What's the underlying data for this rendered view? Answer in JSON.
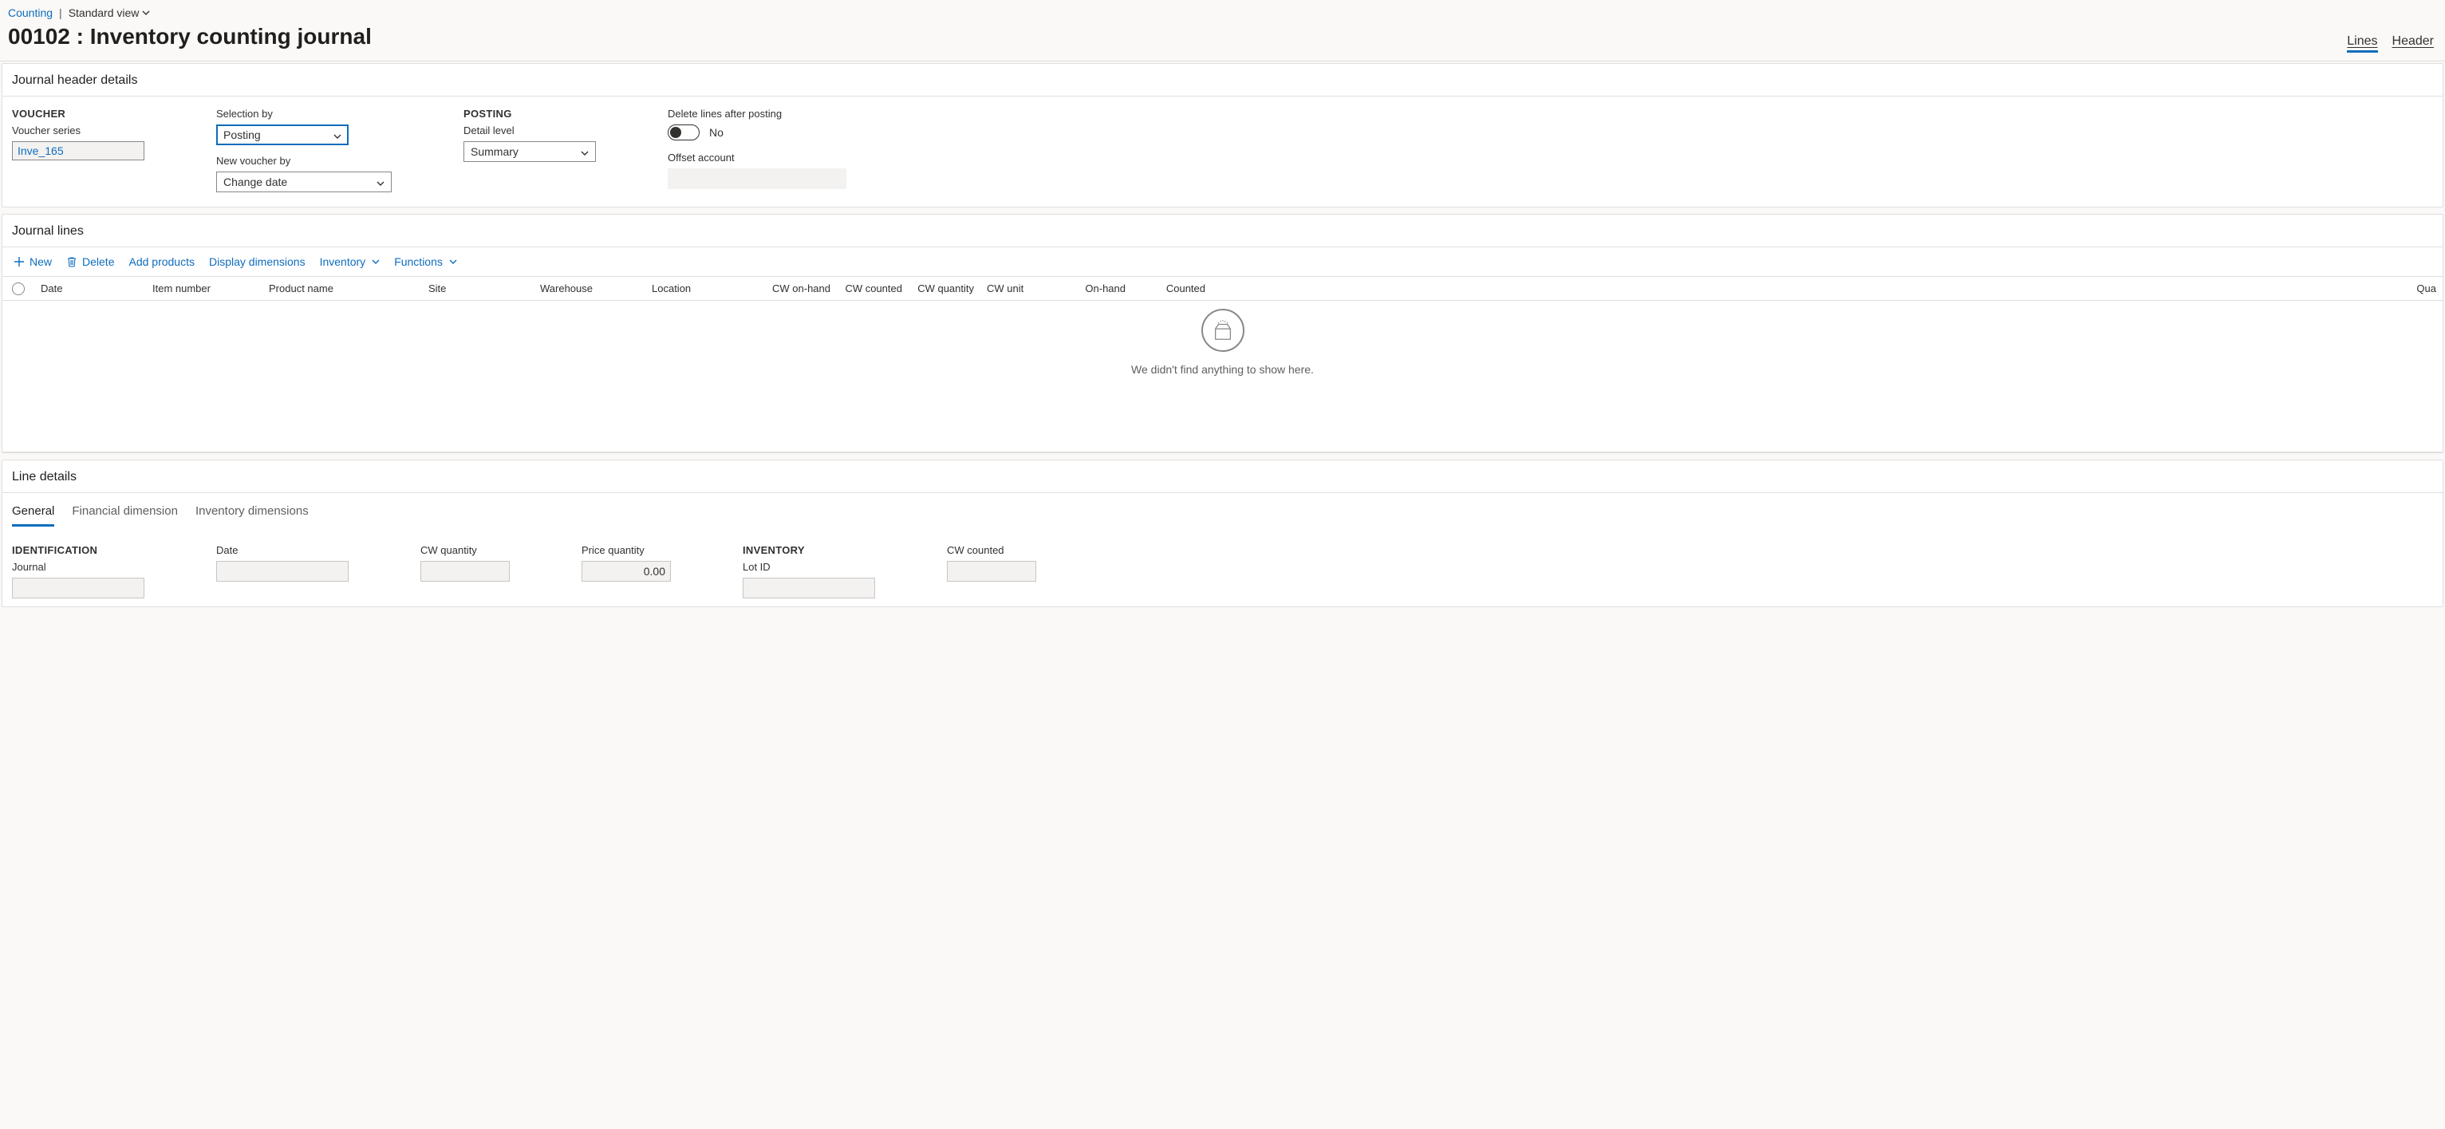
{
  "breadcrumb": {
    "link": "Counting",
    "view_label": "Standard view"
  },
  "title": "00102 : Inventory counting journal",
  "viewTabs": {
    "lines": "Lines",
    "header": "Header"
  },
  "sections": {
    "header_details": "Journal header details",
    "journal_lines": "Journal lines",
    "line_details": "Line details"
  },
  "headerDetails": {
    "voucher_group": "VOUCHER",
    "voucher_series_label": "Voucher series",
    "voucher_series_value": "Inve_165",
    "selection_by_label": "Selection by",
    "selection_by_value": "Posting",
    "new_voucher_by_label": "New voucher by",
    "new_voucher_by_value": "Change date",
    "posting_group": "POSTING",
    "detail_level_label": "Detail level",
    "detail_level_value": "Summary",
    "delete_lines_label": "Delete lines after posting",
    "toggle_text": "No",
    "offset_account_label": "Offset account"
  },
  "linesToolbar": {
    "new": "New",
    "delete": "Delete",
    "add_products": "Add products",
    "display_dimensions": "Display dimensions",
    "inventory": "Inventory",
    "functions": "Functions"
  },
  "linesColumns": {
    "date": "Date",
    "item_number": "Item number",
    "product_name": "Product name",
    "site": "Site",
    "warehouse": "Warehouse",
    "location": "Location",
    "cw_on_hand": "CW on-hand",
    "cw_counted": "CW counted",
    "cw_quantity": "CW quantity",
    "cw_unit": "CW unit",
    "on_hand": "On-hand",
    "counted": "Counted",
    "quantity": "Qua"
  },
  "empty_message": "We didn't find anything to show here.",
  "detailTabs": {
    "general": "General",
    "financial_dimension": "Financial dimension",
    "inventory_dimensions": "Inventory dimensions"
  },
  "lineDetails": {
    "identification_group": "IDENTIFICATION",
    "journal_label": "Journal",
    "date_label": "Date",
    "cw_quantity_label": "CW quantity",
    "price_quantity_label": "Price quantity",
    "price_quantity_value": "0.00",
    "inventory_group": "INVENTORY",
    "lot_id_label": "Lot ID",
    "cw_counted_label": "CW counted"
  }
}
